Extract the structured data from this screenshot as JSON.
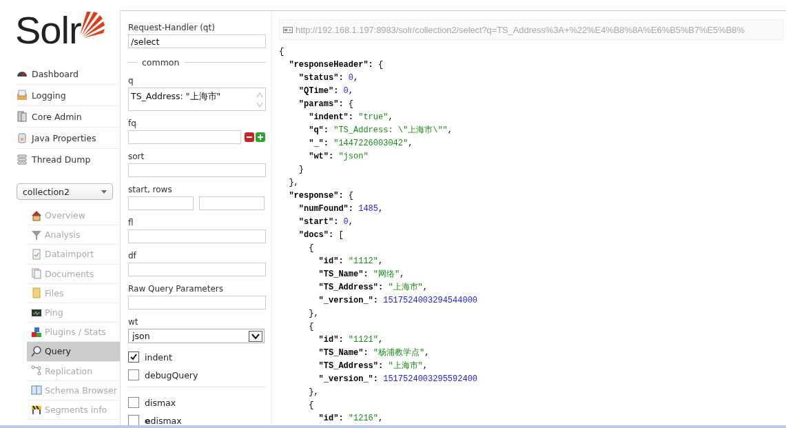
{
  "logo": {
    "text": "Solr"
  },
  "nav": [
    {
      "label": "Dashboard"
    },
    {
      "label": "Logging"
    },
    {
      "label": "Core Admin"
    },
    {
      "label": "Java Properties"
    },
    {
      "label": "Thread Dump"
    }
  ],
  "core_selector": {
    "value": "collection2"
  },
  "core_menu": [
    {
      "label": "Overview",
      "selected": false
    },
    {
      "label": "Analysis",
      "selected": false
    },
    {
      "label": "Dataimport",
      "selected": false
    },
    {
      "label": "Documents",
      "selected": false
    },
    {
      "label": "Files",
      "selected": false
    },
    {
      "label": "Ping",
      "selected": false
    },
    {
      "label": "Plugins / Stats",
      "selected": false
    },
    {
      "label": "Query",
      "selected": true
    },
    {
      "label": "Replication",
      "selected": false
    },
    {
      "label": "Schema Browser",
      "selected": false
    },
    {
      "label": "Segments info",
      "selected": false
    }
  ],
  "form": {
    "fields": [
      {
        "kind": "text",
        "label": "Request-Handler (qt)",
        "value": "/select"
      },
      {
        "kind": "section",
        "label": "common"
      },
      {
        "kind": "textarea",
        "label": "q",
        "value": "TS_Address: \"上海市\""
      },
      {
        "kind": "multi",
        "label": "fq"
      },
      {
        "kind": "text",
        "label": "sort"
      },
      {
        "kind": "pair",
        "label": "start, rows"
      },
      {
        "kind": "text",
        "label": "fl"
      },
      {
        "kind": "text",
        "label": "df"
      },
      {
        "kind": "text",
        "label": "Raw Query Parameters"
      },
      {
        "kind": "select",
        "label": "wt",
        "value": "json"
      },
      {
        "kind": "checkbox",
        "label": "indent",
        "checked": true
      },
      {
        "kind": "checkbox",
        "label": "debugQuery",
        "checked": false
      },
      {
        "kind": "divider"
      },
      {
        "kind": "checkbox",
        "label": "dismax",
        "checked": false
      },
      {
        "kind": "checkbox",
        "label": "**e**dismax",
        "checked": false
      }
    ]
  },
  "result": {
    "url": "http://192.168.1.197:8983/solr/collection2/select?q=TS_Address%3A+%22%E4%B8%8A%E6%B5%B7%E5%B8%",
    "json": {
      "open": "{",
      "children": [
        {
          "key": "\"responseHeader\":",
          "open": "{",
          "close": "},",
          "children": [
            {
              "key": "\"status\":",
              "value": "0",
              "kind": "number",
              "end": ","
            },
            {
              "key": "\"QTime\":",
              "value": "0",
              "kind": "number",
              "end": ","
            },
            {
              "key": "\"params\":",
              "open": "{",
              "close": "}",
              "children": [
                {
                  "key": "\"indent\":",
                  "value": "\"true\"",
                  "kind": "string",
                  "end": ","
                },
                {
                  "key": "\"q\":",
                  "value": "\"TS_Address: \\\"上海市\\\"\"",
                  "kind": "string",
                  "end": ","
                },
                {
                  "key": "\"_\":",
                  "value": "\"1447226003042\"",
                  "kind": "string",
                  "end": ","
                },
                {
                  "key": "\"wt\":",
                  "value": "\"json\"",
                  "kind": "string"
                }
              ]
            }
          ]
        },
        {
          "key": "\"response\":",
          "open": "{",
          "children": [
            {
              "key": "\"numFound\":",
              "value": "1485",
              "kind": "number",
              "end": ","
            },
            {
              "key": "\"start\":",
              "value": "0",
              "kind": "number",
              "end": ","
            },
            {
              "key": "\"docs\":",
              "open": "[",
              "children": [
                {
                  "open": "{",
                  "close": "},",
                  "children": [
                    {
                      "key": "\"id\":",
                      "value": "\"1112\"",
                      "kind": "string",
                      "end": ","
                    },
                    {
                      "key": "\"TS_Name\":",
                      "value": "\"网络\"",
                      "kind": "string",
                      "end": ","
                    },
                    {
                      "key": "\"TS_Address\":",
                      "value": "\"上海市\"",
                      "kind": "string",
                      "end": ","
                    },
                    {
                      "key": "\"_version_\":",
                      "value": "1517524003294544000",
                      "kind": "number"
                    }
                  ]
                },
                {
                  "open": "{",
                  "close": "},",
                  "children": [
                    {
                      "key": "\"id\":",
                      "value": "\"1121\"",
                      "kind": "string",
                      "end": ","
                    },
                    {
                      "key": "\"TS_Name\":",
                      "value": "\"杨浦教学点\"",
                      "kind": "string",
                      "end": ","
                    },
                    {
                      "key": "\"TS_Address\":",
                      "value": "\"上海市\"",
                      "kind": "string",
                      "end": ","
                    },
                    {
                      "key": "\"_version_\":",
                      "value": "1517524003295592400",
                      "kind": "number"
                    }
                  ]
                },
                {
                  "open": "{",
                  "children": [
                    {
                      "key": "\"id\":",
                      "value": "\"1216\"",
                      "kind": "string",
                      "end": ","
                    }
                  ]
                }
              ]
            }
          ]
        }
      ]
    }
  }
}
